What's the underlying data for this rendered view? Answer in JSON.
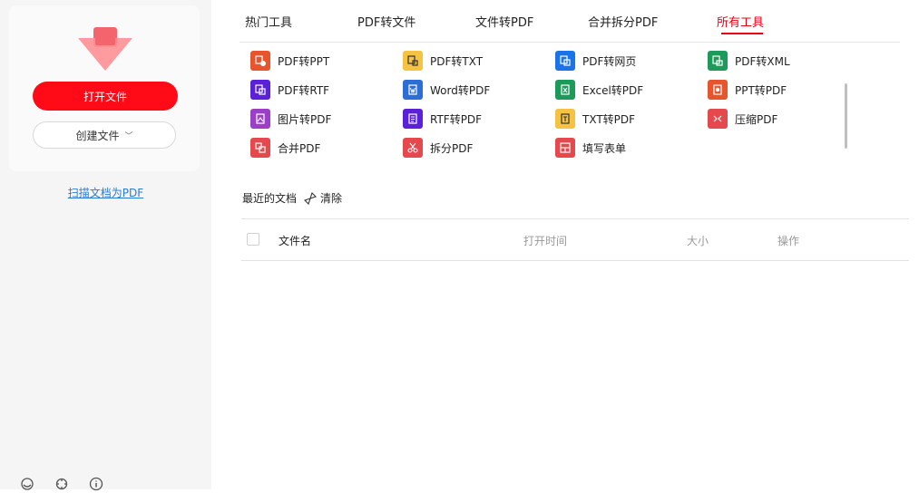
{
  "colors": {
    "accent": "#e60012",
    "primary_button": "#ff0a16",
    "link": "#2a7bd4",
    "sidebar_bg": "#f5f5f5"
  },
  "sidebar": {
    "open_button": "打开文件",
    "create_button": "创建文件",
    "scan_link": "扫描文档为PDF",
    "footer_icons": [
      "support-icon",
      "settings-tools-icon",
      "info-icon"
    ]
  },
  "tabs": [
    {
      "label": "热门工具",
      "active": false
    },
    {
      "label": "PDF转文件",
      "active": false
    },
    {
      "label": "文件转PDF",
      "active": false
    },
    {
      "label": "合并拆分PDF",
      "active": false
    },
    {
      "label": "所有工具",
      "active": true
    }
  ],
  "tools": [
    {
      "label": "PDF转PPT",
      "icon": "pdf-to-ppt-icon",
      "color": "#e8542c"
    },
    {
      "label": "PDF转TXT",
      "icon": "pdf-to-txt-icon",
      "color": "#f5c242"
    },
    {
      "label": "PDF转网页",
      "icon": "pdf-to-web-icon",
      "color": "#1a73e8"
    },
    {
      "label": "PDF转XML",
      "icon": "pdf-to-xml-icon",
      "color": "#1b9a59"
    },
    {
      "label": "PDF转RTF",
      "icon": "pdf-to-rtf-icon",
      "color": "#5b21d9"
    },
    {
      "label": "Word转PDF",
      "icon": "word-to-pdf-icon",
      "color": "#2b6fd6"
    },
    {
      "label": "Excel转PDF",
      "icon": "excel-to-pdf-icon",
      "color": "#1b9a59"
    },
    {
      "label": "PPT转PDF",
      "icon": "ppt-to-pdf-icon",
      "color": "#e8542c"
    },
    {
      "label": "图片转PDF",
      "icon": "image-to-pdf-icon",
      "color": "#9b3fc9"
    },
    {
      "label": "RTF转PDF",
      "icon": "rtf-to-pdf-icon",
      "color": "#5b21d9"
    },
    {
      "label": "TXT转PDF",
      "icon": "txt-to-pdf-icon",
      "color": "#f5c242"
    },
    {
      "label": "压缩PDF",
      "icon": "compress-pdf-icon",
      "color": "#e5484d"
    },
    {
      "label": "合并PDF",
      "icon": "merge-pdf-icon",
      "color": "#e5484d"
    },
    {
      "label": "拆分PDF",
      "icon": "split-pdf-icon",
      "color": "#e5484d"
    },
    {
      "label": "填写表单",
      "icon": "fill-form-icon",
      "color": "#e5484d"
    }
  ],
  "recent": {
    "title": "最近的文档",
    "clear_label": "清除"
  },
  "table": {
    "columns": [
      "文件名",
      "打开时间",
      "大小",
      "操作"
    ]
  }
}
